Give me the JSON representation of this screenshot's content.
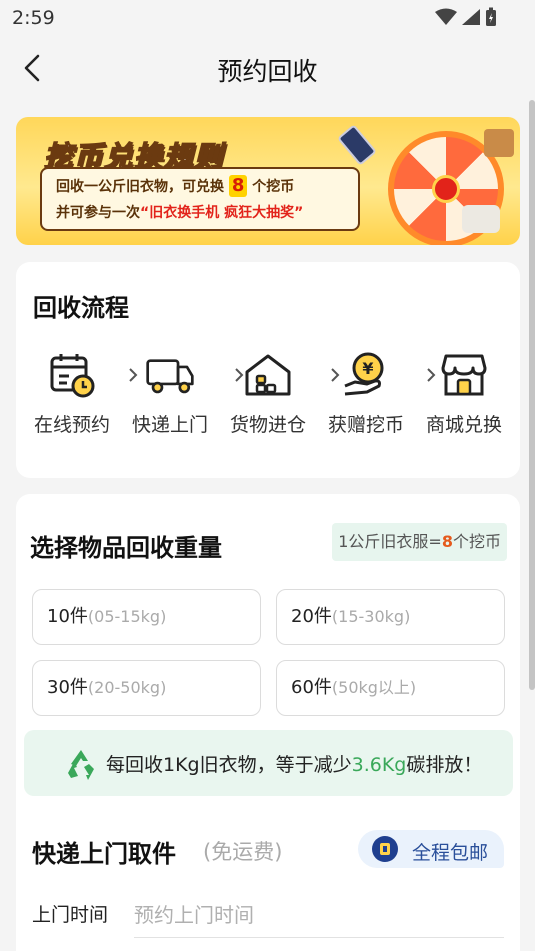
{
  "status_bar": {
    "time": "2:59"
  },
  "header": {
    "title": "预约回收"
  },
  "banner": {
    "title": "挖币兑换规则",
    "line1_prefix": "回收一公斤旧衣物，可兑换",
    "line1_number": "8",
    "line1_suffix": "个挖币",
    "line2_prefix": "并可参与一次",
    "line2_highlight": "“旧衣换手机 疯狂大抽奖”"
  },
  "process": {
    "title": "回收流程",
    "steps": [
      {
        "label": "在线预约",
        "icon": "calendar-clock-icon"
      },
      {
        "label": "快递上门",
        "icon": "delivery-truck-icon"
      },
      {
        "label": "货物进仓",
        "icon": "warehouse-icon"
      },
      {
        "label": "获赠挖币",
        "icon": "coin-hand-icon"
      },
      {
        "label": "商城兑换",
        "icon": "store-icon"
      }
    ]
  },
  "weight": {
    "title": "选择物品回收重量",
    "rate_prefix": "1公斤旧衣服=",
    "rate_number": "8",
    "rate_suffix": "个挖币",
    "options": [
      {
        "count": "10件",
        "range": "(05-15kg)"
      },
      {
        "count": "20件",
        "range": "(15-30kg)"
      },
      {
        "count": "30件",
        "range": "(20-50kg)"
      },
      {
        "count": "60件",
        "range": "(50kg以上)"
      }
    ],
    "eco_prefix": "每回收1Kg旧衣物，等于减少",
    "eco_value": "3.6Kg",
    "eco_suffix": "碳排放！"
  },
  "pickup": {
    "title": "快递上门取件",
    "free_note": "(免运费)",
    "free_ship_label": "全程包邮",
    "time_label": "上门时间",
    "time_placeholder": "预约上门时间"
  },
  "colors": {
    "accent_green": "#3aa85a",
    "accent_orange": "#e55a1c",
    "banner_yellow": "#ffd75a"
  }
}
